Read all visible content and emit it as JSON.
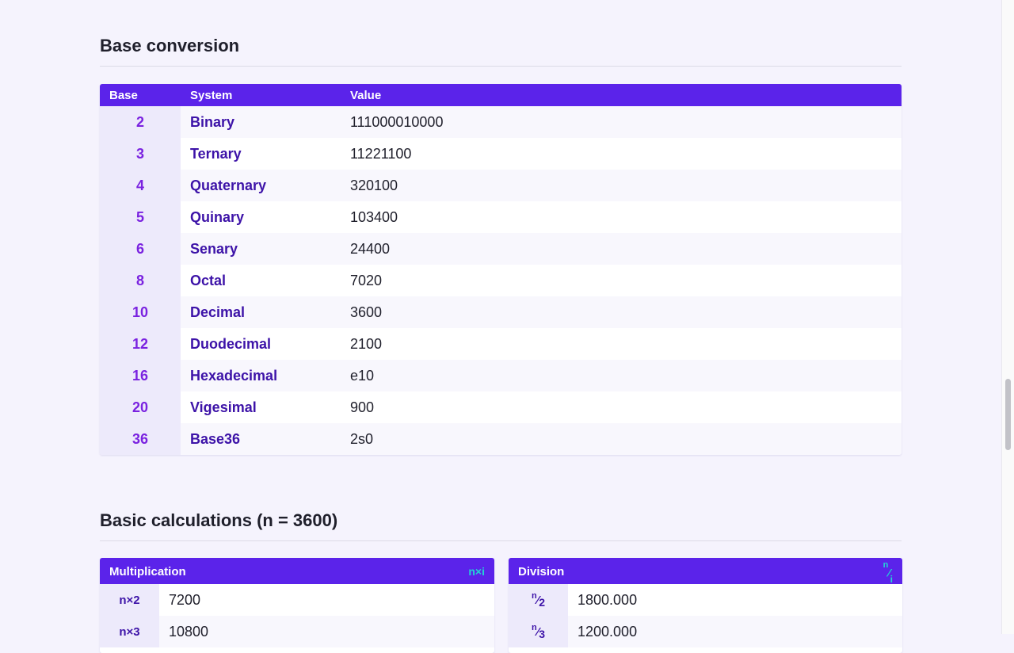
{
  "base_conversion": {
    "title": "Base conversion",
    "headers": {
      "base": "Base",
      "system": "System",
      "value": "Value"
    },
    "rows": [
      {
        "base": "2",
        "system": "Binary",
        "value": "111000010000"
      },
      {
        "base": "3",
        "system": "Ternary",
        "value": "11221100"
      },
      {
        "base": "4",
        "system": "Quaternary",
        "value": "320100"
      },
      {
        "base": "5",
        "system": "Quinary",
        "value": "103400"
      },
      {
        "base": "6",
        "system": "Senary",
        "value": "24400"
      },
      {
        "base": "8",
        "system": "Octal",
        "value": "7020"
      },
      {
        "base": "10",
        "system": "Decimal",
        "value": "3600"
      },
      {
        "base": "12",
        "system": "Duodecimal",
        "value": "2100"
      },
      {
        "base": "16",
        "system": "Hexadecimal",
        "value": "e10"
      },
      {
        "base": "20",
        "system": "Vigesimal",
        "value": "900"
      },
      {
        "base": "36",
        "system": "Base36",
        "value": "2s0"
      }
    ]
  },
  "basic_calculations": {
    "title": "Basic calculations (n = 3600)",
    "multiplication": {
      "title": "Multiplication",
      "symbol": "n×i",
      "rows": [
        {
          "label": "n×2",
          "value": "7200"
        },
        {
          "label": "n×3",
          "value": "10800"
        }
      ]
    },
    "division": {
      "title": "Division",
      "symbol_num": "n",
      "symbol_slash": "⁄",
      "symbol_den": "i",
      "rows": [
        {
          "num": "n",
          "den": "2",
          "value": "1800.000"
        },
        {
          "num": "n",
          "den": "3",
          "value": "1200.000"
        }
      ]
    }
  },
  "colors": {
    "accent": "#5b23ea",
    "base_number": "#7a22e0",
    "system_name": "#3d13a8",
    "symbol": "#21d4d4",
    "background": "#f5f3fd"
  }
}
